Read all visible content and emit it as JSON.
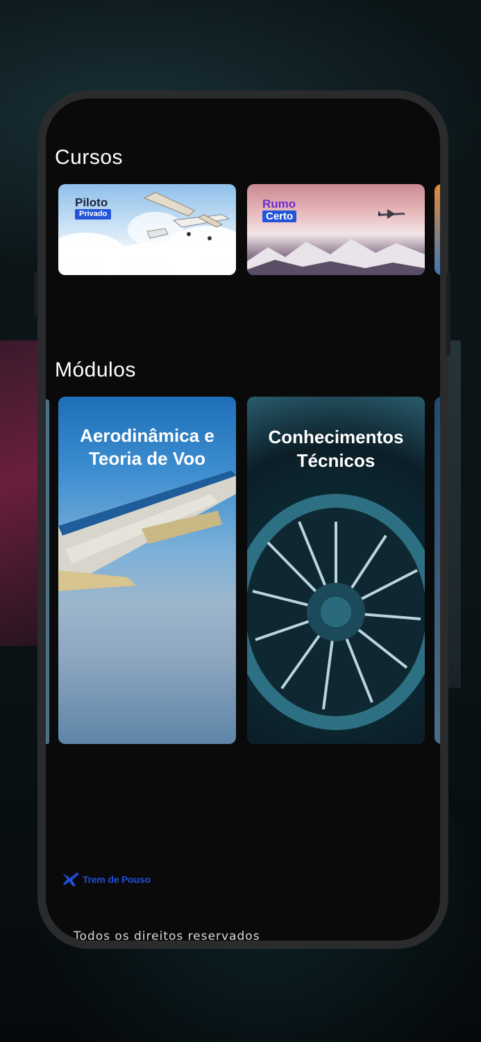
{
  "sections": {
    "courses_title": "Cursos",
    "modules_title": "Módulos"
  },
  "courses": [
    {
      "logo_line1": "Piloto",
      "logo_line2": "Privado"
    },
    {
      "logo_line1": "Rumo",
      "logo_line2": "Certo"
    }
  ],
  "modules": [
    {
      "title_line1": "Aerodinâmica e",
      "title_line2": "Teoria de Voo"
    },
    {
      "title_line1": "Conhecimentos",
      "title_line2": "Técnicos"
    }
  ],
  "footer": {
    "brand": "Trem de Pouso",
    "copyright": "Todos os direitos reservados"
  },
  "colors": {
    "screen_bg": "#0a0a0a",
    "brand_blue": "#1f4ed8"
  },
  "icons": [
    "airplane-icon",
    "brand-logo-icon"
  ]
}
